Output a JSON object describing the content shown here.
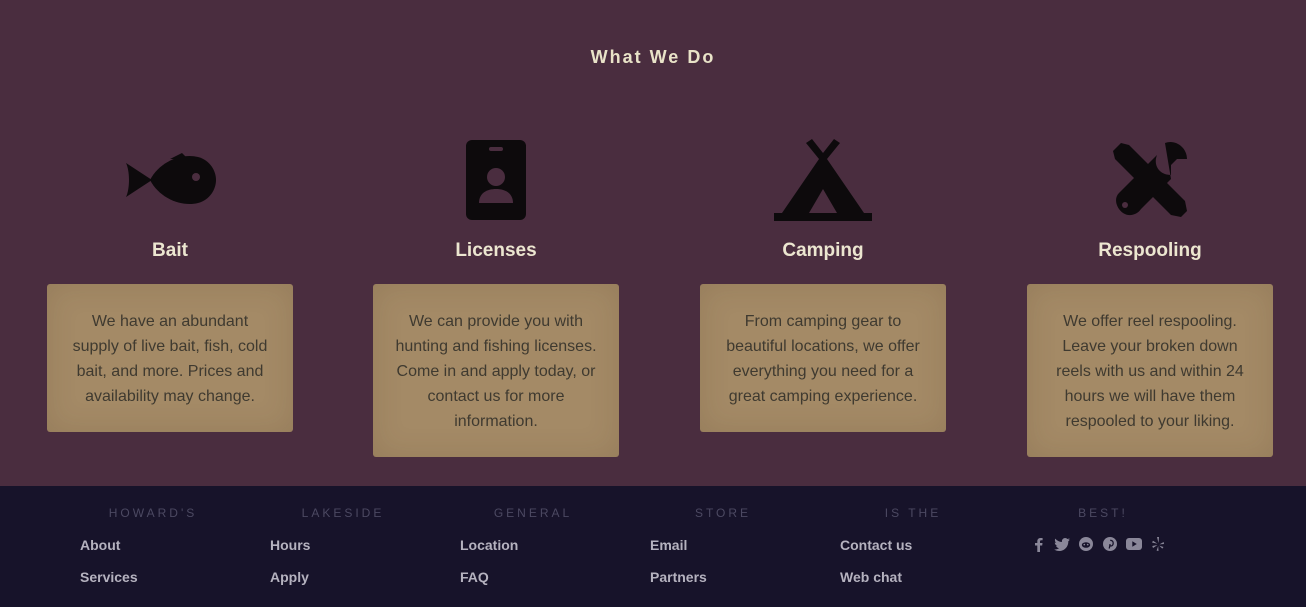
{
  "section": {
    "title": "What We Do",
    "items": [
      {
        "icon": "fish-icon",
        "heading": "Bait",
        "text": "We have an abundant supply of live bait, fish, cold bait, and more. Prices and availability may change."
      },
      {
        "icon": "id-badge-icon",
        "heading": "Licenses",
        "text": "We can provide you with hunting and fishing licenses. Come in and apply today, or contact us for more information."
      },
      {
        "icon": "tent-icon",
        "heading": "Camping",
        "text": "From camping gear to beautiful locations, we offer everything you need for a great camping experience."
      },
      {
        "icon": "tools-icon",
        "heading": "Respooling",
        "text": "We offer reel respooling. Leave your broken down reels with us and within 24 hours we will have them respooled to your liking."
      }
    ]
  },
  "footer": {
    "columns": [
      {
        "heading": "HOWARD'S",
        "links": [
          "About",
          "Services"
        ]
      },
      {
        "heading": "LAKESIDE",
        "links": [
          "Hours",
          "Apply"
        ]
      },
      {
        "heading": "GENERAL",
        "links": [
          "Location",
          "FAQ"
        ]
      },
      {
        "heading": "STORE",
        "links": [
          "Email",
          "Partners"
        ]
      },
      {
        "heading": "IS THE",
        "links": [
          "Contact us",
          "Web chat"
        ]
      },
      {
        "heading": "BEST!",
        "links": []
      }
    ],
    "social": [
      "facebook-icon",
      "twitter-icon",
      "reddit-icon",
      "pinterest-icon",
      "youtube-icon",
      "yelp-icon"
    ]
  },
  "colors": {
    "section_bg": "#4a2d3f",
    "card_bg": "#a48a66",
    "footer_bg": "#17132a",
    "heading_text": "#ece6d0"
  }
}
